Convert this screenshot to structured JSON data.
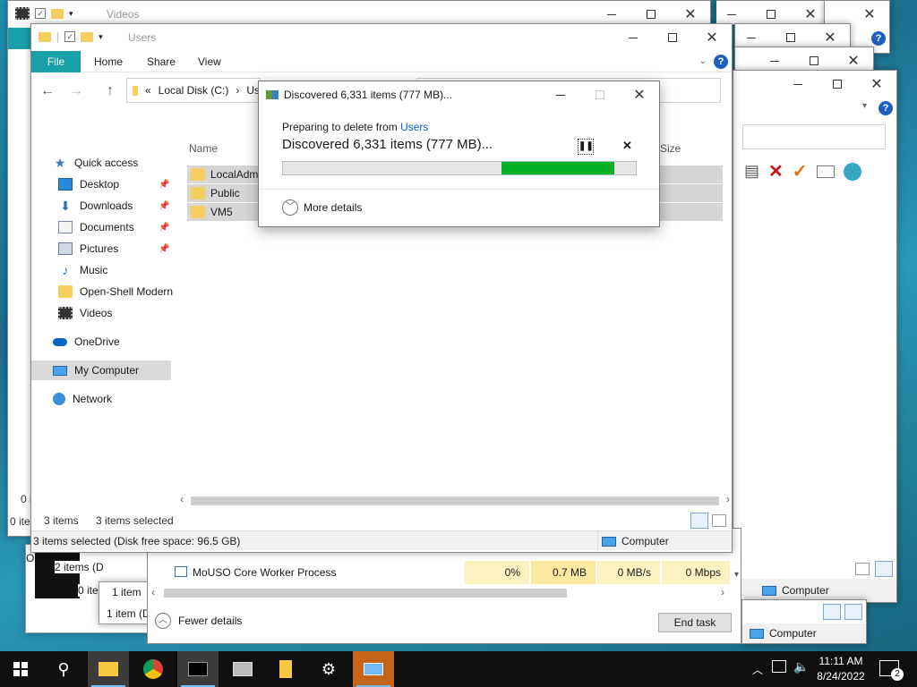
{
  "back_windows": {
    "videos_title": "Videos",
    "left_fragments": [
      "0 i",
      "0 ite",
      "0 ite",
      "O",
      "1 item",
      "1 item (D",
      "2 items (D"
    ]
  },
  "explorer": {
    "title": "Users",
    "ribbon": {
      "file": "File",
      "home": "Home",
      "share": "Share",
      "view": "View"
    },
    "address": {
      "chevrons": "«",
      "drive": "Local Disk (C:)",
      "sep": "›",
      "folder": "Us"
    },
    "nav": {
      "quick_access": "Quick access",
      "desktop": "Desktop",
      "downloads": "Downloads",
      "documents": "Documents",
      "pictures": "Pictures",
      "music": "Music",
      "openshell": "Open-Shell Modern",
      "videos": "Videos",
      "onedrive": "OneDrive",
      "my_computer": "My Computer",
      "network": "Network"
    },
    "columns": {
      "name": "Name",
      "size": "Size"
    },
    "files": [
      "LocalAdmi",
      "Public",
      "VM5"
    ],
    "status_count": "3 items",
    "status_selected": "3 items selected",
    "status_bar": "3 items selected (Disk free space: 96.5 GB)",
    "status_location": "Computer"
  },
  "right_explorer": {
    "status_location": "Computer",
    "status_location_2": "Computer"
  },
  "task_manager": {
    "process_name": "MoUSO Core Worker Process",
    "cpu": "0%",
    "memory": "0.7 MB",
    "disk": "0 MB/s",
    "network": "0 Mbps",
    "fewer_details": "Fewer details",
    "end_task": "End task"
  },
  "delete_dialog": {
    "title": "Discovered 6,331 items (777 MB)...",
    "preparing_prefix": "Preparing to delete from",
    "preparing_link": "Users",
    "heading": "Discovered 6,331 items (777 MB)...",
    "more_details": "More details",
    "progress_start": 0.62,
    "progress_end": 0.94
  },
  "taskbar": {
    "time": "11:11 AM",
    "date": "8/24/2022",
    "notifications": "2"
  },
  "colors": {
    "accent": "#199fa8",
    "progress": "#06b025",
    "link": "#0066cc"
  }
}
